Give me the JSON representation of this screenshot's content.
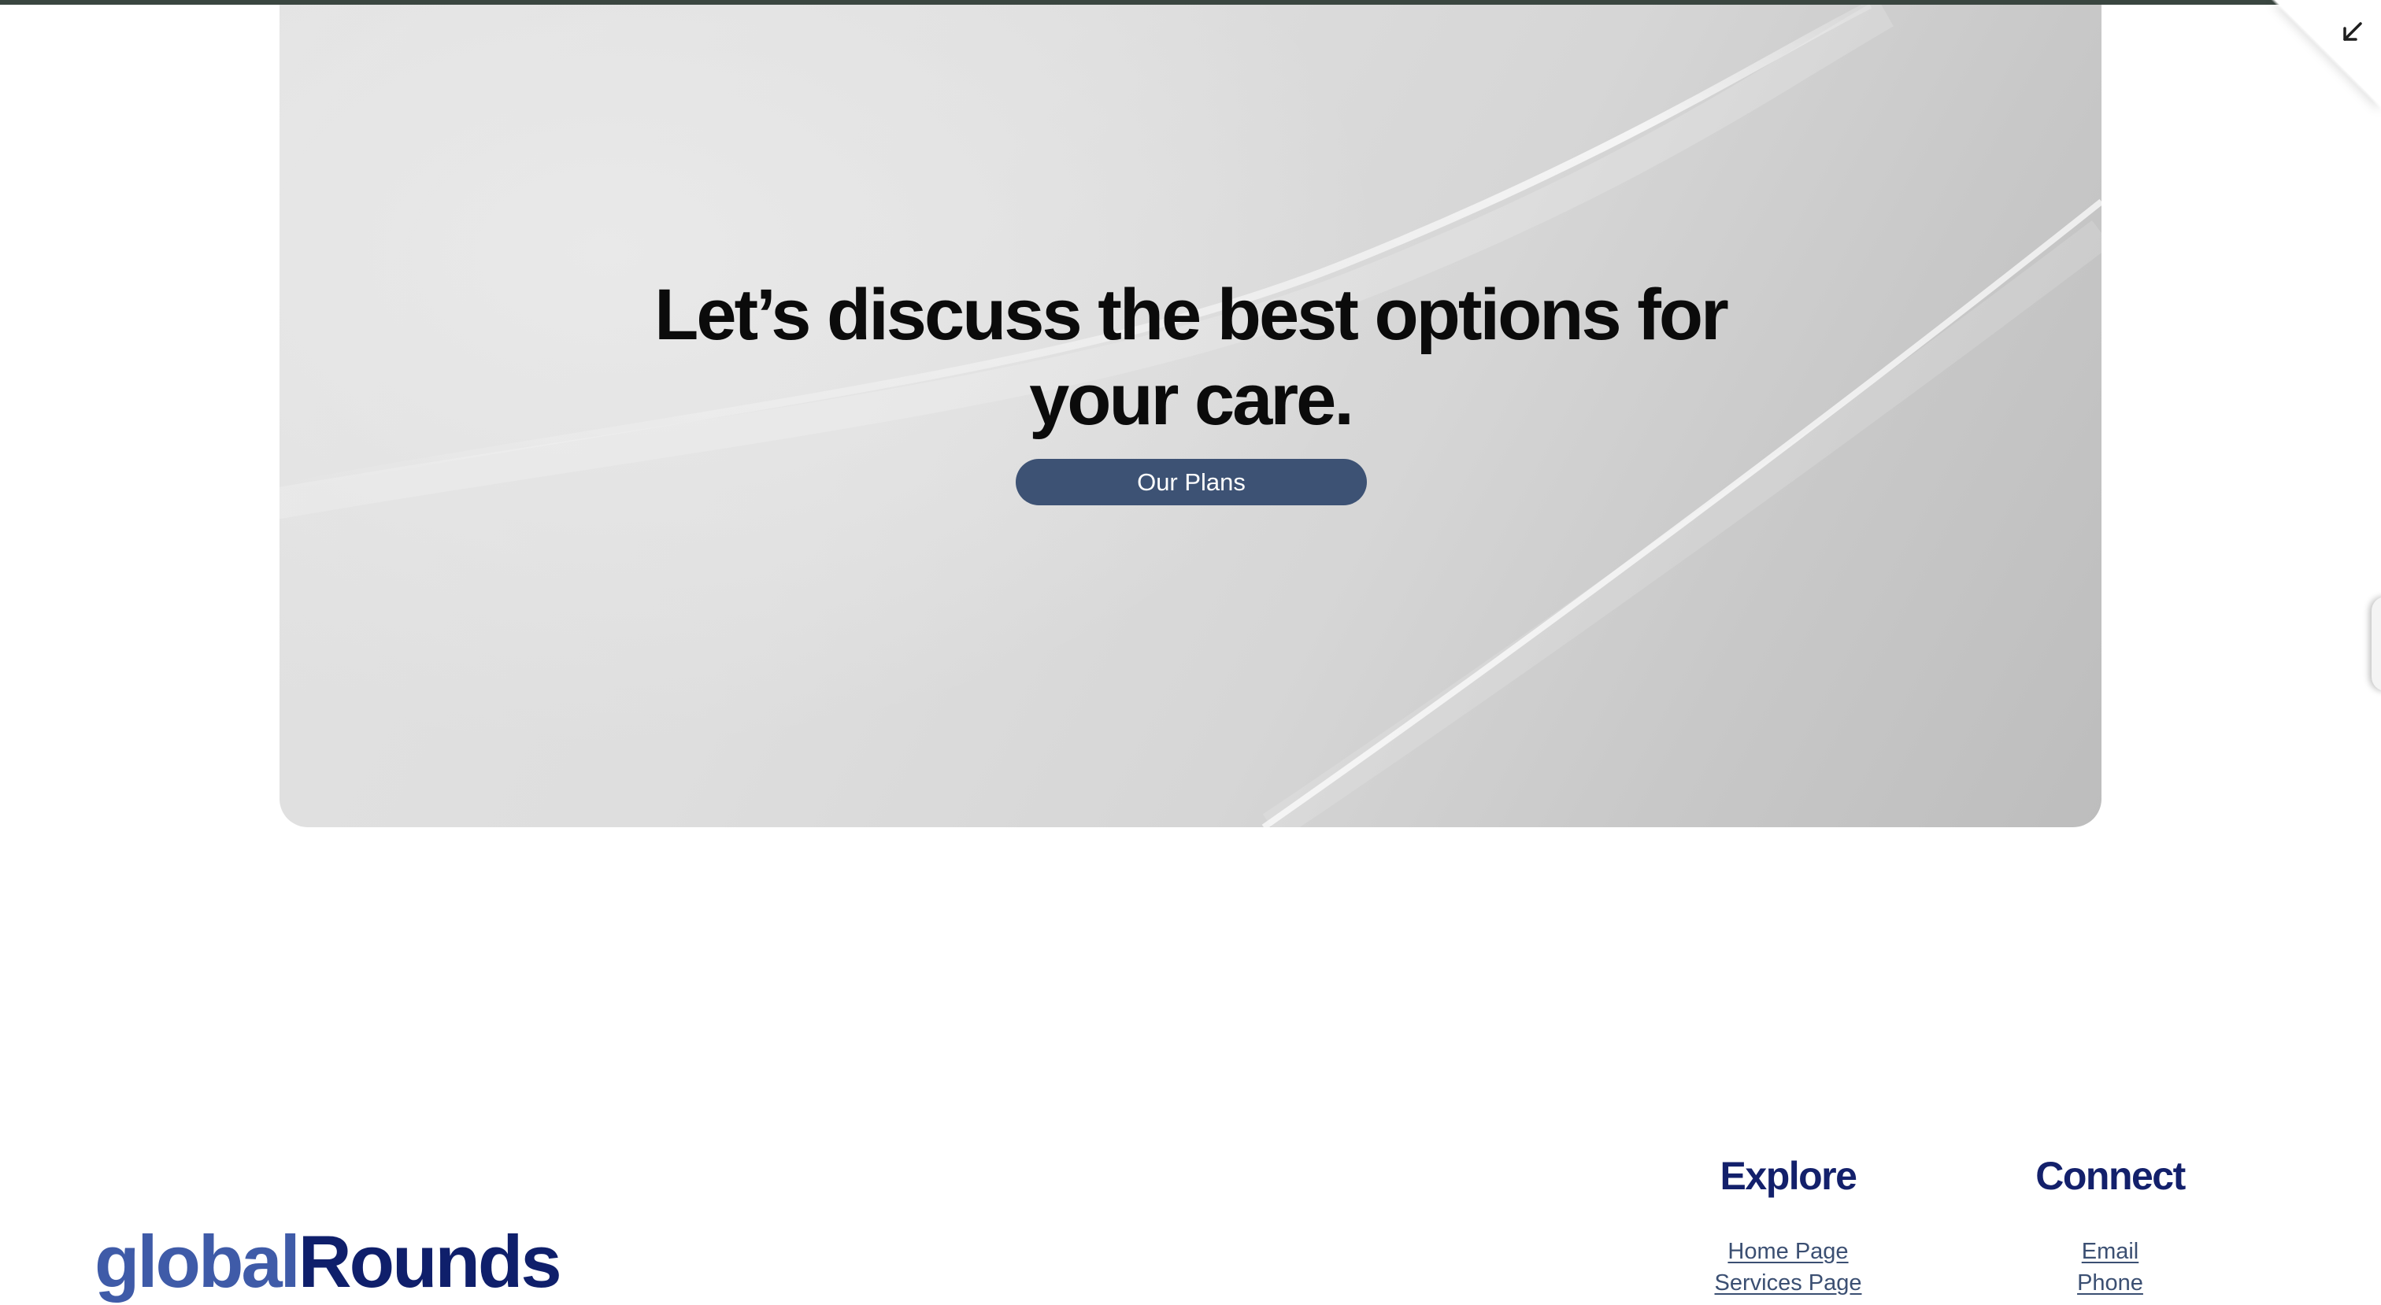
{
  "hero": {
    "headline_line1": "Let’s discuss the best options for",
    "headline_line2": "your care.",
    "cta_label": "Our Plans",
    "cta_color": "#3d5274"
  },
  "corner": {
    "icon": "arrow-down-left-icon"
  },
  "footer": {
    "logo_part1": "global",
    "logo_part2": "Rounds",
    "logo_color_light": "#3f5ba8",
    "logo_color_dark": "#0f1f6b",
    "explore": {
      "heading": "Explore",
      "links": [
        "Home Page",
        "Services Page"
      ]
    },
    "connect": {
      "heading": "Connect",
      "links": [
        "Email",
        "Phone"
      ]
    }
  }
}
